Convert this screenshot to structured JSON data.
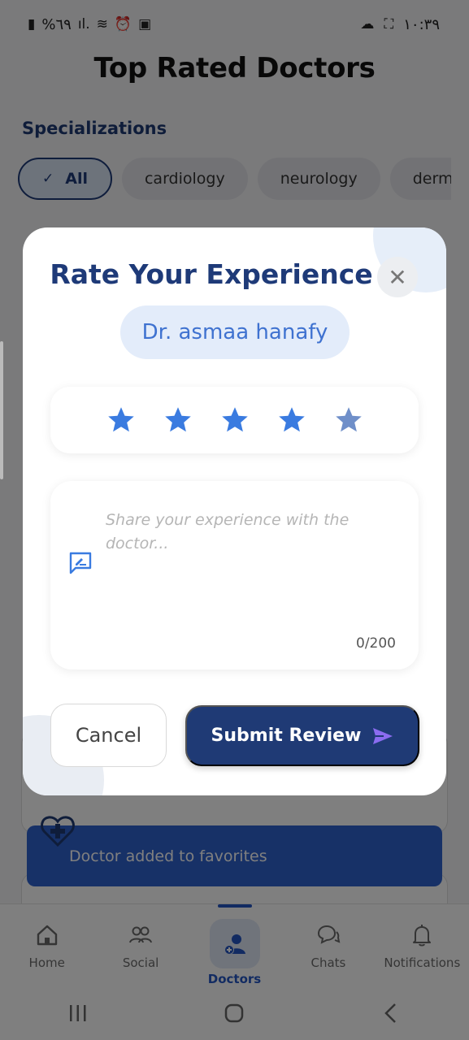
{
  "status_bar": {
    "battery": "%٦٩",
    "time": "١٠:٣٩"
  },
  "header": {
    "title": "Top Rated Doctors"
  },
  "specializations": {
    "title": "Specializations",
    "chips": [
      {
        "label": "All",
        "selected": true
      },
      {
        "label": "cardiology",
        "selected": false
      },
      {
        "label": "neurology",
        "selected": false
      },
      {
        "label": "derm",
        "selected": false
      }
    ]
  },
  "toast": {
    "message": "Doctor added to favorites"
  },
  "bottom_nav": {
    "items": [
      {
        "label": "Home",
        "icon": "home-icon"
      },
      {
        "label": "Social",
        "icon": "people-icon"
      },
      {
        "label": "Doctors",
        "icon": "doctor-icon",
        "active": true
      },
      {
        "label": "Chats",
        "icon": "chat-icon"
      },
      {
        "label": "Notifications",
        "icon": "bell-icon"
      }
    ]
  },
  "modal": {
    "title": "Rate Your Experience",
    "doctor_name": "Dr. asmaa hanafy",
    "rating": {
      "value": 5,
      "max": 5
    },
    "review": {
      "placeholder": "Share your experience with the doctor...",
      "value": "",
      "counter": "0/200"
    },
    "cancel_label": "Cancel",
    "submit_label": "Submit Review"
  },
  "colors": {
    "primary": "#1f3a75",
    "accent": "#2f62cf",
    "star": "#3a7be0",
    "send_icon": "#8b6cf0"
  }
}
